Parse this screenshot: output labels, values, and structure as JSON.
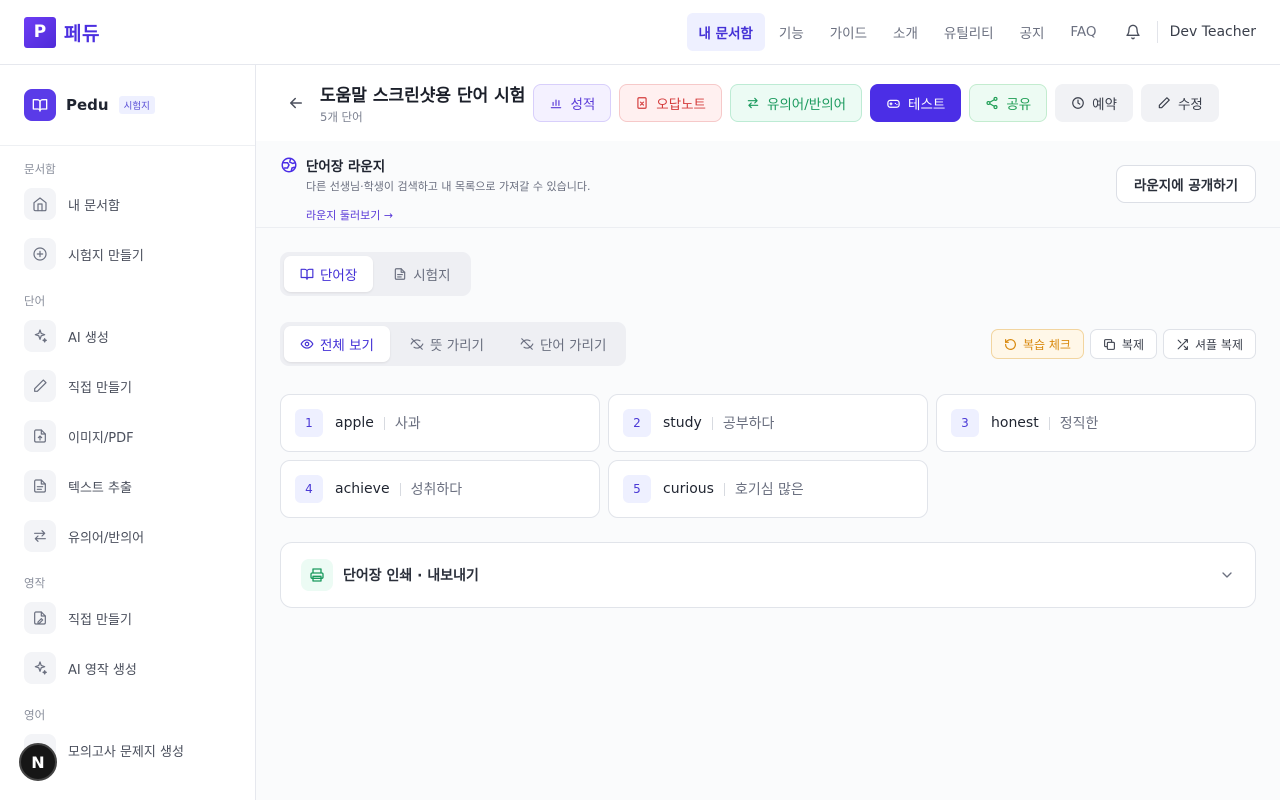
{
  "brand": {
    "logo_letter": "P",
    "name": "페듀",
    "accent": "#4b2ee6"
  },
  "topnav": {
    "items": [
      "내 문서함",
      "기능",
      "가이드",
      "소개",
      "유틸리티",
      "공지",
      "FAQ"
    ],
    "active": "내 문서함",
    "user": "Dev Teacher",
    "bell_icon": "bell-icon"
  },
  "sidebar": {
    "title": "Pedu",
    "badge": "시험지",
    "sections": [
      {
        "label": "문서함",
        "items": [
          "내 문서함",
          "시험지 만들기"
        ]
      },
      {
        "label": "단어",
        "items": [
          "AI 생성",
          "직접 만들기",
          "이미지/PDF",
          "텍스트 추출",
          "유의어/반의어"
        ]
      },
      {
        "label": "영작",
        "items": [
          "직접 만들기",
          "AI 영작 생성"
        ]
      },
      {
        "label": "영어",
        "items": [
          "모의고사 문제지 생성"
        ]
      }
    ],
    "floating_badge": "N"
  },
  "header": {
    "title": "도움말 스크린샷용 단어 시험",
    "subtitle": "5개 단어",
    "actions": {
      "grade": "성적",
      "wrong": "오답노트",
      "syn": "유의어/반의어",
      "test": "테스트",
      "share": "공유",
      "schedule": "예약",
      "edit": "수정"
    }
  },
  "lounge": {
    "title": "단어장 라운지",
    "description": "다른 선생님·학생이 검색하고 내 목록으로 가져갈 수 있습니다.",
    "link": "라운지 둘러보기 →",
    "button": "라운지에 공개하기"
  },
  "tabs": {
    "wordbook": "단어장",
    "test_paper": "시험지"
  },
  "view_modes": {
    "all": "전체 보기",
    "hide_meaning": "뜻 가리기",
    "hide_word": "단어 가리기"
  },
  "tools": {
    "review": "복습 체크",
    "copy": "복제",
    "shuffle": "셔플 복제"
  },
  "words": [
    {
      "no": "1",
      "word": "apple",
      "meaning": "사과"
    },
    {
      "no": "2",
      "word": "study",
      "meaning": "공부하다"
    },
    {
      "no": "3",
      "word": "honest",
      "meaning": "정직한"
    },
    {
      "no": "4",
      "word": "achieve",
      "meaning": "성취하다"
    },
    {
      "no": "5",
      "word": "curious",
      "meaning": "호기심 많은"
    }
  ],
  "print_export": {
    "label": "단어장 인쇄 · 내보내기"
  }
}
